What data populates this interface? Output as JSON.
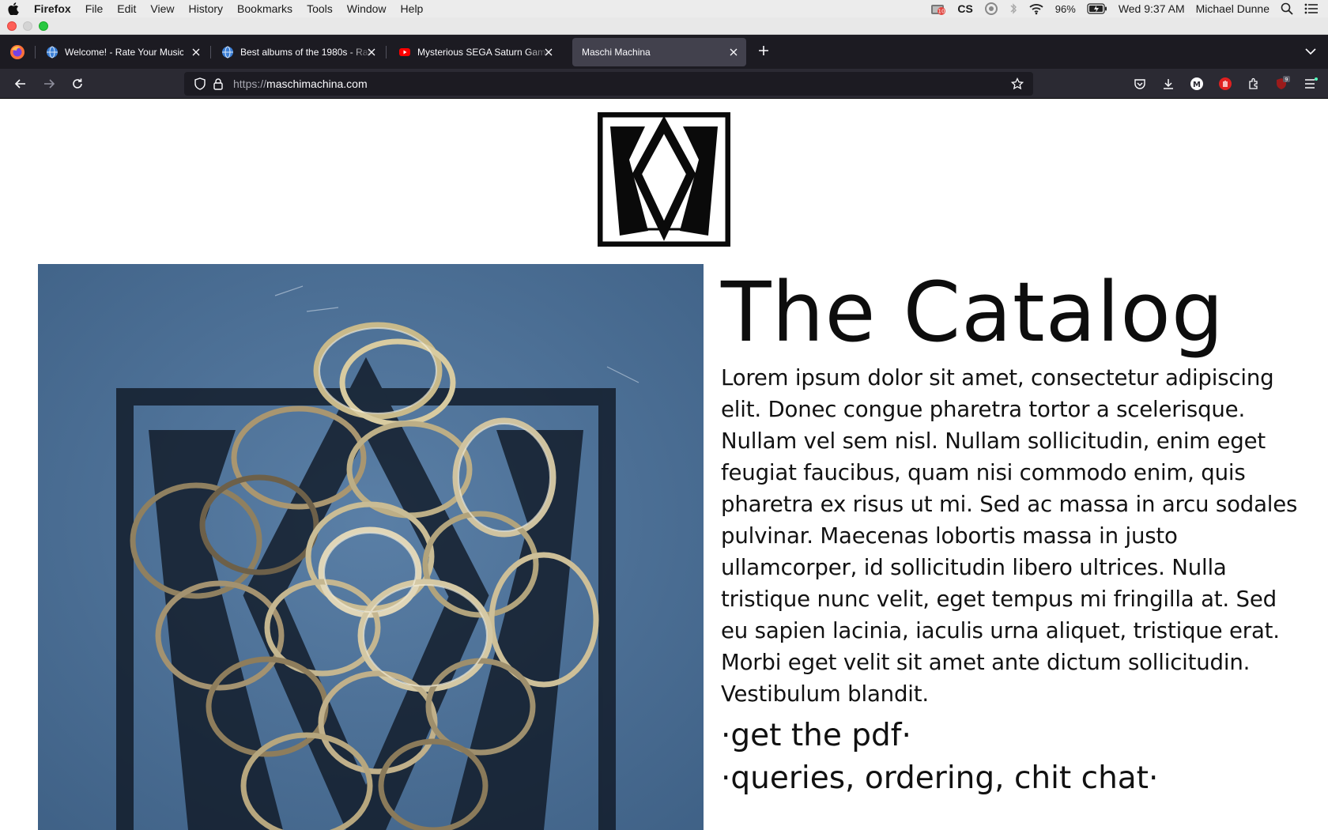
{
  "menubar": {
    "app_name": "Firefox",
    "menus": [
      "File",
      "Edit",
      "View",
      "History",
      "Bookmarks",
      "Tools",
      "Window",
      "Help"
    ],
    "battery": "96%",
    "datetime": "Wed 9:37 AM",
    "user": "Michael Dunne",
    "notification_badge": "10",
    "cs_label": "CS"
  },
  "tabs": [
    {
      "title": "Welcome! - Rate Your Music",
      "favicon": "globe-icon"
    },
    {
      "title": "Best albums of the 1980s - Rate Your Music",
      "favicon": "globe-icon"
    },
    {
      "title": "Mysterious SEGA Saturn Games",
      "favicon": "youtube-icon"
    },
    {
      "title": "Maschi Machina",
      "favicon": "none",
      "active": true
    }
  ],
  "navbar": {
    "url_scheme": "https://",
    "url_host": "maschimachina.com",
    "extension_badge": "9"
  },
  "page": {
    "title": "The Catalog",
    "body": "Lorem ipsum dolor sit amet, consectetur adipiscing elit. Donec congue pharetra tortor a scelerisque. Nullam vel sem nisl. Nullam sollicitudin, enim eget feugiat faucibus, quam nisi commodo enim, quis pharetra ex risus ut mi. Sed ac massa in arcu sodales pulvinar. Maecenas lobortis massa in justo ullamcorper, id sollicitudin libero ultrices. Nulla tristique nunc velit, eget tempus mi fringilla at. Sed eu sapien lacinia, iaculis urna aliquet, tristique erat. Morbi eget velit sit amet ante dictum sollicitudin. Vestibulum blandit.",
    "link_pdf": "·get the pdf·",
    "link_contact": "·queries, ordering, chit chat·"
  },
  "colors": {
    "tabbar_bg": "#1c1b22",
    "navbar_bg": "#2b2a33",
    "active_tab": "#42414d",
    "photo_bg": "#4a6e95"
  }
}
